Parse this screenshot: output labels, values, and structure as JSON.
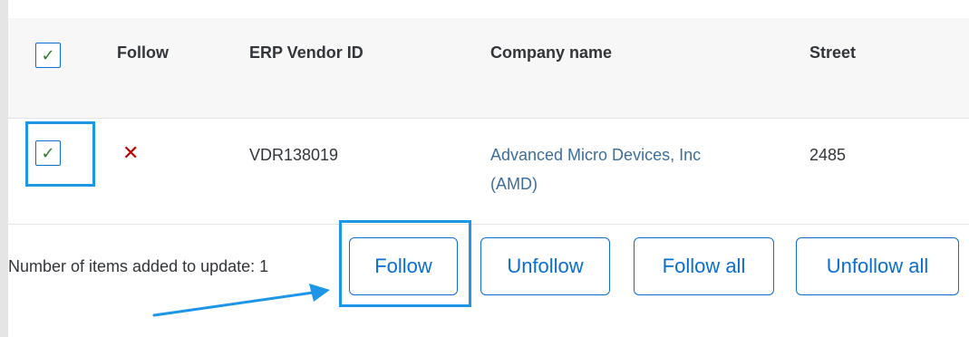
{
  "table": {
    "columns": {
      "follow": "Follow",
      "erp_vendor_id": "ERP Vendor ID",
      "company_name": "Company name",
      "street": "Street"
    },
    "select_all_checked": true,
    "rows": [
      {
        "selected": true,
        "follow_status": "not-followed",
        "erp_vendor_id": "VDR138019",
        "company_name_line1": "Advanced Micro Devices, Inc",
        "company_name_line2": "(AMD)",
        "street": "2485"
      }
    ]
  },
  "footer": {
    "items_label": "Number of items added to update: 1",
    "buttons": {
      "follow": "Follow",
      "unfollow": "Unfollow",
      "follow_all": "Follow all",
      "unfollow_all": "Unfollow all"
    }
  },
  "icons": {
    "checkmark": "check-icon",
    "not_followed": "close-icon",
    "annotation_arrow": "arrow-icon"
  },
  "colors": {
    "accent": "#0a6ed1",
    "highlight": "#1e96e8",
    "check": "#2b7d2b",
    "unfollow_x": "#bb0000",
    "link": "#3d6f9a"
  }
}
